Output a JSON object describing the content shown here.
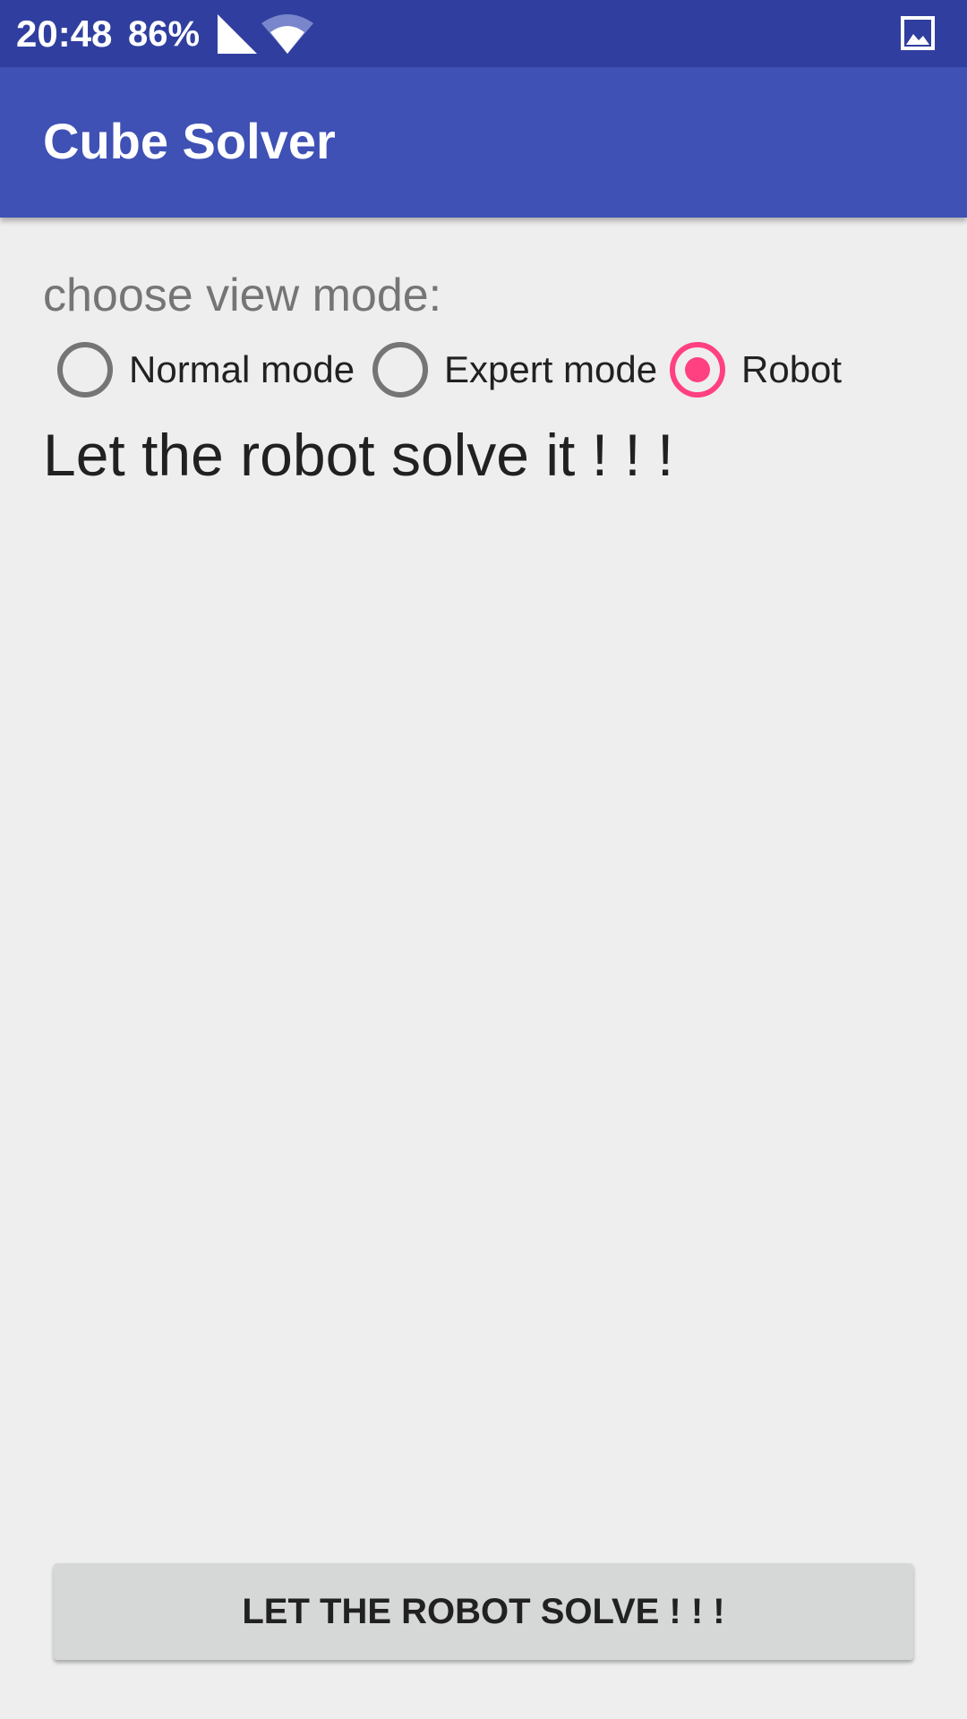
{
  "status_bar": {
    "time": "20:48",
    "battery": "86%",
    "icons": [
      "signal-icon",
      "wifi-icon",
      "image-icon"
    ]
  },
  "app_bar": {
    "title": "Cube Solver",
    "color": "#3f51b5"
  },
  "view_mode": {
    "label": "choose view mode:",
    "options": [
      {
        "label": "Normal mode",
        "checked": false
      },
      {
        "label": "Expert mode",
        "checked": false
      },
      {
        "label": "Robot",
        "checked": true
      }
    ],
    "accent_color": "#ff4081"
  },
  "message": "Let the robot solve it ! ! !",
  "solve_button": {
    "label": "LET THE ROBOT SOLVE ! ! !"
  }
}
